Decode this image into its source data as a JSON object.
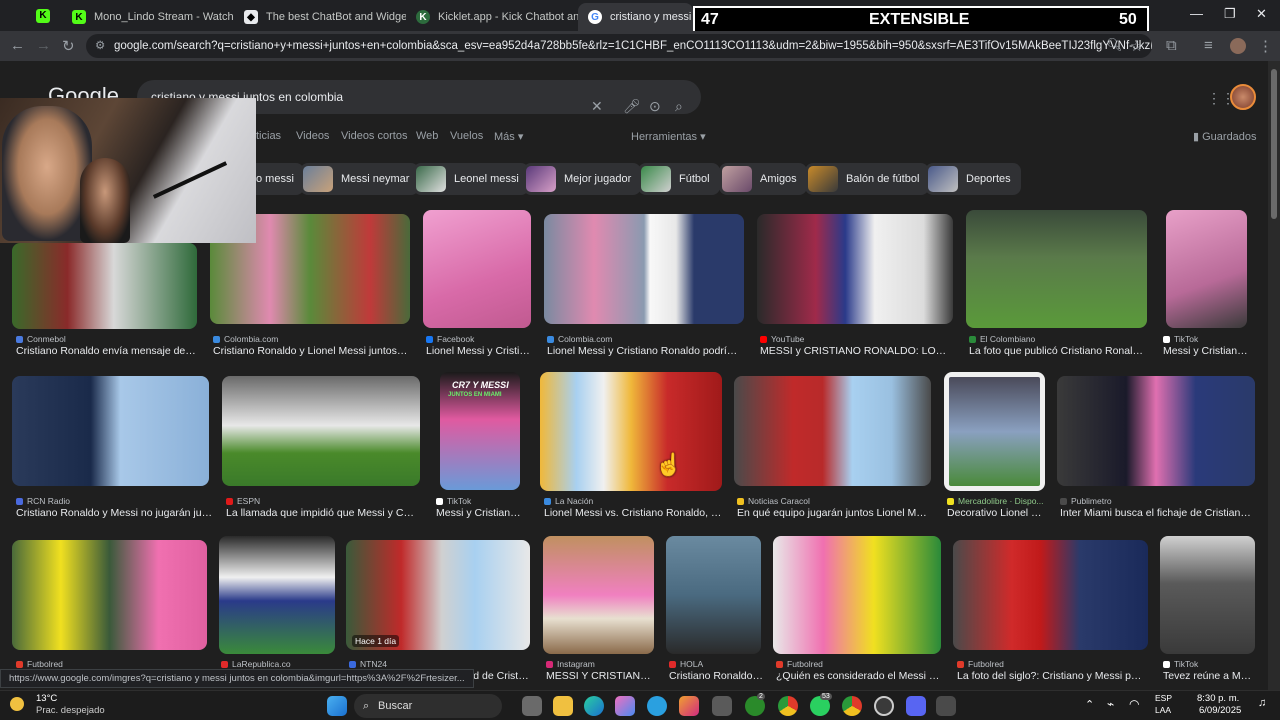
{
  "tabs": [
    {
      "title": "Mono_Lindo Stream - Watch Li…",
      "favicon": "kick-icon"
    },
    {
      "title": "The best ChatBot and Widgets",
      "favicon": "kick-icon"
    },
    {
      "title": "Kicklet.app - Kick Chatbot and C",
      "favicon": "kicklet-icon"
    },
    {
      "title": "cristiano y messi junto",
      "favicon": "google-icon"
    }
  ],
  "address": "google.com/search?q=cristiano+y+messi+juntos+en+colombia&sca_esv=ea952d4a728bb5fe&rlz=1C1CHBF_enCO1113CO1113&udm=2&biw=1955&bih=950&sxsrf=AE3TifOv15MAkBeeTIJ23flgYVNf-JkzKw%3A17572...",
  "overlay": {
    "left": "47",
    "center": "EXTENSIBLE",
    "right": "50"
  },
  "logo": "Google",
  "search": {
    "query": "cristiano y messi juntos en colombia"
  },
  "filters": [
    "ticias",
    "Videos",
    "Videos cortos",
    "Web",
    "Vuelos",
    "Más ▾"
  ],
  "tools": "Herramientas ▾",
  "saved": "Guardados",
  "chips": [
    "o messi",
    "Messi neymar",
    "Leonel messi",
    "Mejor jugador",
    "Fútbol",
    "Amigos",
    "Balón de fútbol",
    "Deportes"
  ],
  "results": [
    {
      "source": "Conmebol",
      "title": "Cristiano Ronaldo envía mensaje de ap..."
    },
    {
      "source": "Colombia.com",
      "title": "Cristiano Ronaldo y Lionel Messi juntos? Es..."
    },
    {
      "source": "Facebook",
      "title": "Lionel Messi y Cristia..."
    },
    {
      "source": "Colombia.com",
      "title": "Lionel Messi y Cristiano Ronaldo podrían ju..."
    },
    {
      "source": "YouTube",
      "title": "MESSI y CRISTIANO RONALDO: LOS ME..."
    },
    {
      "source": "El Colombiano",
      "title": "La foto que publicó Cristiano Ronaldo j..."
    },
    {
      "source": "TikTok",
      "title": "Messi y Cristiano j..."
    },
    {
      "source": "RCN Radio",
      "title": "Cristiano Ronaldo y Messi no jugarán junto..."
    },
    {
      "source": "ESPN",
      "title": "La llamada que impidió que Messi y Cristia..."
    },
    {
      "source": "TikTok",
      "title": "Messi y Cristiano ..."
    },
    {
      "source": "La Nación",
      "title": "Lionel Messi vs. Cristiano Ronaldo, un..."
    },
    {
      "source": "Noticias Caracol",
      "title": "En qué equipo jugarán juntos Lionel Messi ..."
    },
    {
      "source": "Mercadolibre · Dispo...",
      "title": "Decorativo Lionel M..."
    },
    {
      "source": "Publimetro",
      "title": "Inter Miami busca el fichaje de Cristiano Ro..."
    },
    {
      "source": "Futbolred",
      "title": ""
    },
    {
      "source": "LaRepublica.co",
      "title": ""
    },
    {
      "source": "NTN24",
      "title": "ó un récord de Cristia..."
    },
    {
      "source": "Instagram",
      "title": "MESSI Y CRISTIANO ..."
    },
    {
      "source": "HOLA",
      "title": "Cristiano Ronaldo ..."
    },
    {
      "source": "Futbolred",
      "title": "¿Quién es considerado el Messi o ..."
    },
    {
      "source": "Futbolred",
      "title": "La foto del siglo?: Cristiano y Messi posar..."
    },
    {
      "source": "TikTok",
      "title": "Tevez reúne a Mes..."
    }
  ],
  "badges": {
    "hace": "Hace 1 día",
    "card1": "CR7 Y MESSI",
    "card1b": "JUNTOS EN MIAMI"
  },
  "status_url": "https://www.google.com/imgres?q=cristiano y messi juntos en colombia&imgurl=https%3A%2F%2Frtesizer...",
  "weather": {
    "temp": "13°C",
    "desc": "Prac. despejado"
  },
  "taskbar": {
    "search": "Buscar",
    "badge1": "2",
    "badge2": "53"
  },
  "clock": {
    "lang1": "ESP",
    "lang2": "LAA",
    "time": "8:30 p. m.",
    "date": "6/09/2025"
  }
}
